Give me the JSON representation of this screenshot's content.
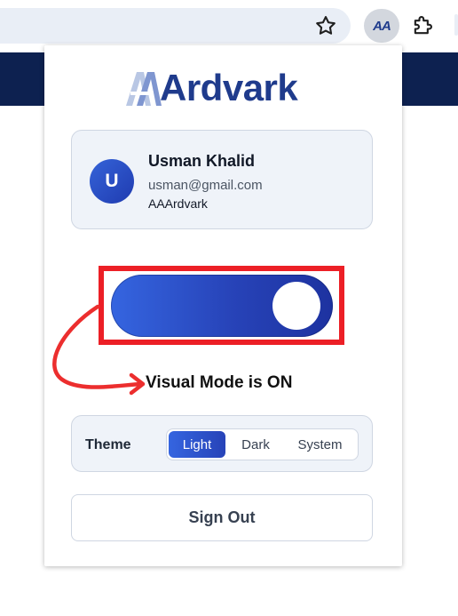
{
  "browser": {
    "star_icon": "bookmark-star-icon",
    "extension_logo_text": "AA",
    "puzzle_icon": "extensions-puzzle-icon"
  },
  "popup": {
    "logo": {
      "text": "Ardvark",
      "mark": "AA"
    },
    "user": {
      "avatar_initial": "U",
      "name": "Usman Khalid",
      "email": "usman@gmail.com",
      "org": "AAArdvark"
    },
    "visual_mode_toggle": {
      "on": true
    },
    "visual_mode_label": "Visual Mode is ON",
    "theme": {
      "label": "Theme",
      "options": [
        "Light",
        "Dark",
        "System"
      ],
      "selected": "Light"
    },
    "sign_out_label": "Sign Out"
  },
  "colors": {
    "brand": "#1f3b8c",
    "accent_gradient_start": "#3565e0",
    "accent_gradient_end": "#1d32a0",
    "highlight_box": "#ec1f26",
    "page_band": "#0d2150"
  }
}
